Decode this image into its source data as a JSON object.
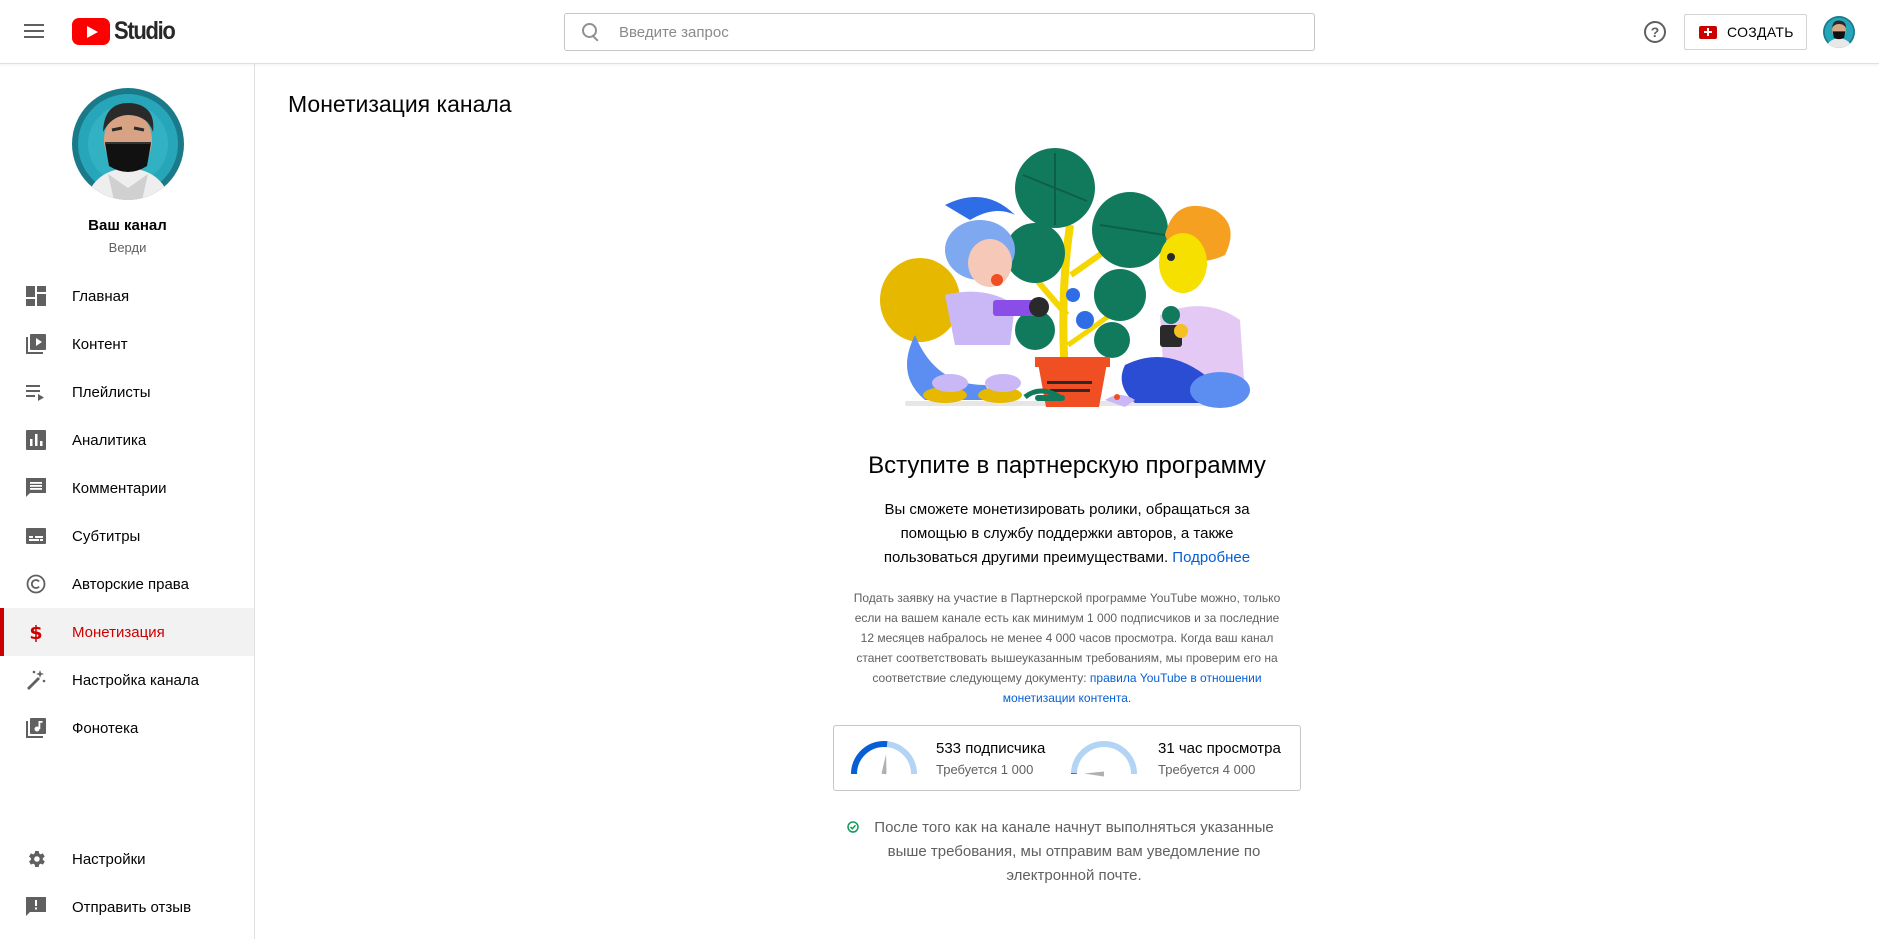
{
  "header": {
    "logo_text": "Studio",
    "search_placeholder": "Введите запрос",
    "help_glyph": "?",
    "create_label": "СОЗДАТЬ"
  },
  "sidebar": {
    "channel_title": "Ваш канал",
    "channel_name": "Верди",
    "items": [
      {
        "label": "Главная",
        "icon": "dashboard-icon"
      },
      {
        "label": "Контент",
        "icon": "video-library-icon"
      },
      {
        "label": "Плейлисты",
        "icon": "playlist-icon"
      },
      {
        "label": "Аналитика",
        "icon": "analytics-icon"
      },
      {
        "label": "Комментарии",
        "icon": "comment-icon"
      },
      {
        "label": "Субтитры",
        "icon": "subtitles-icon"
      },
      {
        "label": "Авторские права",
        "icon": "copyright-icon"
      },
      {
        "label": "Монетизация",
        "icon": "dollar-icon",
        "active": true
      },
      {
        "label": "Настройка канала",
        "icon": "magic-wand-icon"
      },
      {
        "label": "Фонотека",
        "icon": "audio-library-icon"
      }
    ],
    "bottom_items": [
      {
        "label": "Настройки",
        "icon": "gear-icon"
      },
      {
        "label": "Отправить отзыв",
        "icon": "feedback-icon"
      }
    ]
  },
  "main": {
    "page_title": "Монетизация канала",
    "headline": "Вступите в партнерскую программу",
    "description": "Вы сможете монетизировать ролики, обращаться за помощью в службу поддержки авторов, а также пользоваться другими преимуществами.",
    "description_link": "Подробнее",
    "small_description": "Подать заявку на участие в Партнерской программе YouTube можно, только если на вашем канале есть как минимум 1 000 подписчиков и за последние 12 месяцев набралось не менее 4 000 часов просмотра. Когда ваш канал станет соответствовать вышеуказанным требованиям, мы проверим его на соответствие следующему документу:",
    "small_description_link": "правила YouTube в отношении монетизации контента.",
    "requirements": [
      {
        "value": "533 подписчика",
        "required": "Требуется 1 000",
        "progress": 0.533
      },
      {
        "value": "31 час просмотра",
        "required": "Требуется 4 000",
        "progress": 0.008
      }
    ],
    "notice": "После того как на канале начнут выполняться указанные выше требования, мы отправим вам уведомление по электронной почте."
  },
  "colors": {
    "accent_red": "#cc0000",
    "link_blue": "#065fd4",
    "gauge_fill": "#065fd4",
    "gauge_track": "#b3d4f5",
    "notice_green": "#0f9d58"
  }
}
